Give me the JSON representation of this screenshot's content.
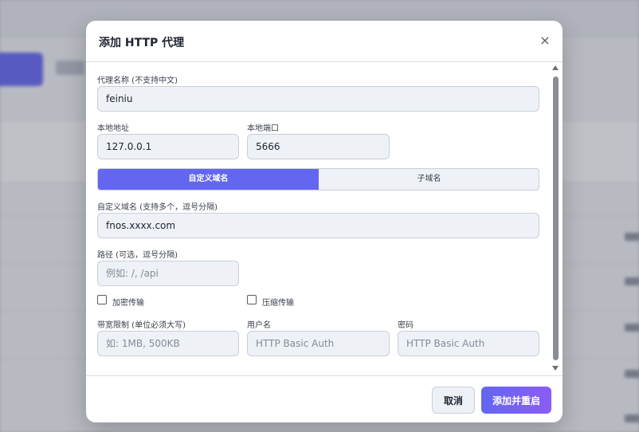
{
  "modal": {
    "title": "添加 HTTP 代理",
    "close_symbol": "×"
  },
  "form": {
    "proxy_name": {
      "label": "代理名称 (不支持中文)",
      "value": "feiniu"
    },
    "local_address": {
      "label": "本地地址",
      "value": "127.0.0.1"
    },
    "local_port": {
      "label": "本地端口",
      "value": "5666"
    },
    "domain_tabs": {
      "active": "自定义域名",
      "items": [
        "自定义域名",
        "子域名"
      ]
    },
    "custom_domains": {
      "label": "自定义域名 (支持多个，逗号分隔)",
      "value": "fnos.xxxx.com"
    },
    "path": {
      "label": "路径 (可选，逗号分隔)",
      "placeholder": "例如: /, /api"
    },
    "encryption": {
      "label": "加密传输",
      "checked": false
    },
    "compression": {
      "label": "压缩传输",
      "checked": false
    },
    "bandwidth": {
      "label": "带宽限制 (单位必须大写)",
      "placeholder": "如: 1MB, 500KB"
    },
    "username": {
      "label": "用户名",
      "placeholder": "HTTP Basic Auth"
    },
    "password": {
      "label": "密码",
      "placeholder": "HTTP Basic Auth"
    }
  },
  "footer": {
    "cancel_label": "取消",
    "submit_label": "添加并重启"
  },
  "colors": {
    "accent": "#6366f1",
    "accent_gradient_end": "#8b5cf6",
    "field_bg": "#eef1f6"
  }
}
